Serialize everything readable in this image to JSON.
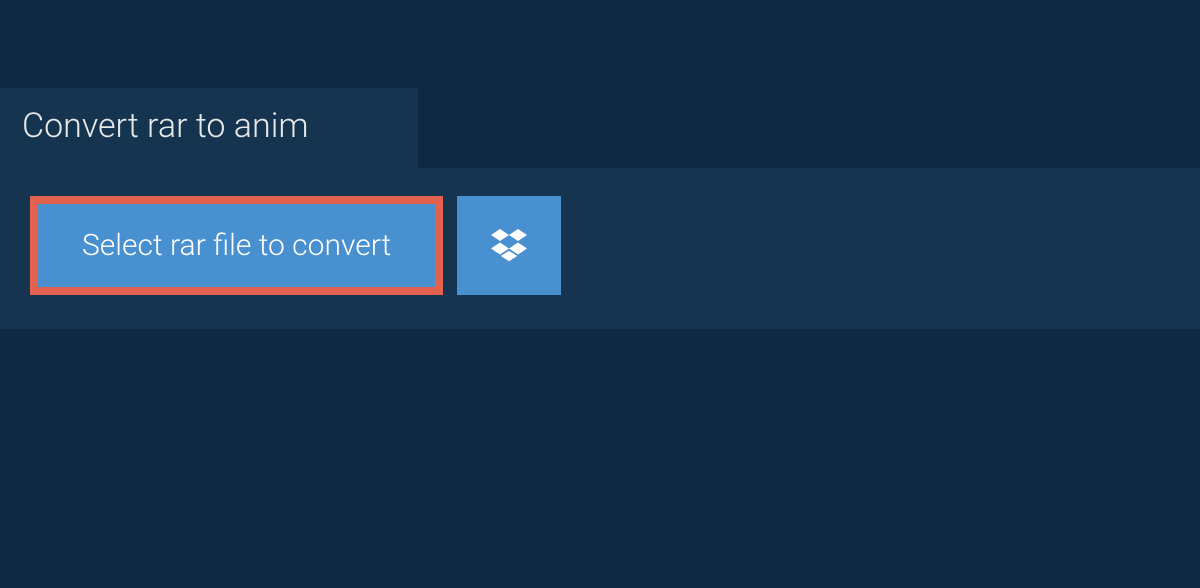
{
  "tab": {
    "title": "Convert rar to anim"
  },
  "actions": {
    "select_file_label": "Select rar file to convert"
  },
  "colors": {
    "page_bg": "#0e2a42",
    "panel_bg": "#14344f",
    "button_bg": "#4990d0",
    "highlight_border": "#e2624f",
    "text_light": "#ffffff"
  }
}
